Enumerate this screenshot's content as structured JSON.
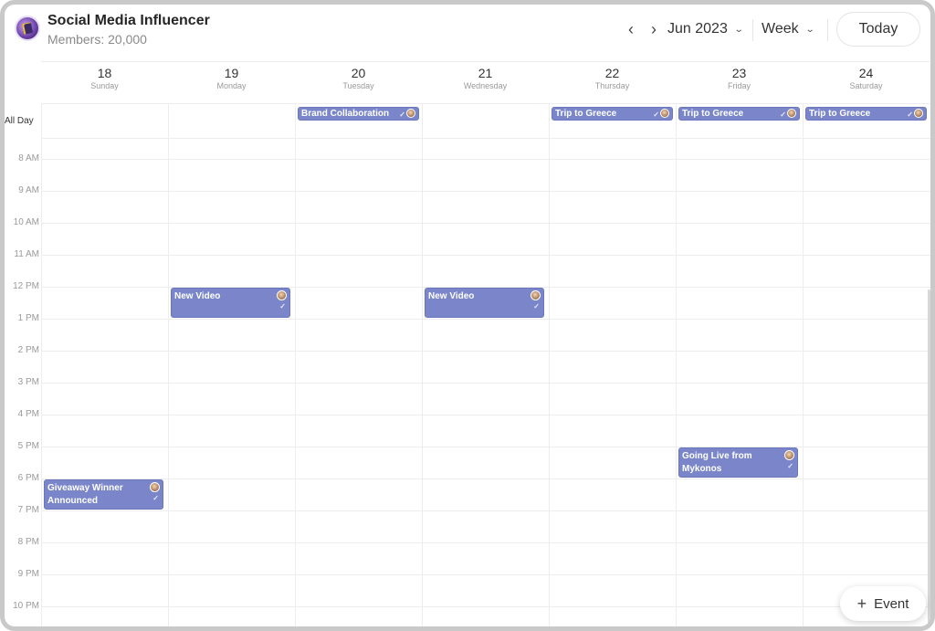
{
  "header": {
    "group_name": "Social Media Influencer",
    "members": "Members: 20,000",
    "month": "Jun 2023",
    "view": "Week",
    "today_label": "Today",
    "prev_icon": "chevron-left-icon",
    "next_icon": "chevron-right-icon"
  },
  "days": [
    {
      "num": "18",
      "name": "Sunday"
    },
    {
      "num": "19",
      "name": "Monday"
    },
    {
      "num": "20",
      "name": "Tuesday"
    },
    {
      "num": "21",
      "name": "Wednesday"
    },
    {
      "num": "22",
      "name": "Thursday"
    },
    {
      "num": "23",
      "name": "Friday"
    },
    {
      "num": "24",
      "name": "Saturday"
    }
  ],
  "all_day_label": "All Day",
  "times": [
    "8 AM",
    "9 AM",
    "10 AM",
    "11 AM",
    "12 PM",
    "1 PM",
    "2 PM",
    "3 PM",
    "4 PM",
    "5 PM",
    "6 PM",
    "7 PM",
    "8 PM",
    "9 PM",
    "10 PM"
  ],
  "all_day_events": [
    {
      "title": "Brand Collaboration",
      "day": "20"
    },
    {
      "title": "Trip to Greece",
      "day": "22"
    },
    {
      "title": "Trip to Greece",
      "day": "23"
    },
    {
      "title": "Trip to Greece",
      "day": "24"
    }
  ],
  "timed_events": [
    {
      "title": "New Video",
      "day": "19",
      "time": "12 PM"
    },
    {
      "title": "New Video",
      "day": "21",
      "time": "12 PM"
    },
    {
      "title": "Going Live from Mykonos",
      "day": "23",
      "time": "5 PM"
    },
    {
      "title": "Giveaway Winner Announced",
      "day": "18",
      "time": "6 PM"
    }
  ],
  "add_event_label": "Event",
  "colors": {
    "event": "#7a86c9",
    "grid": "#ededed"
  }
}
